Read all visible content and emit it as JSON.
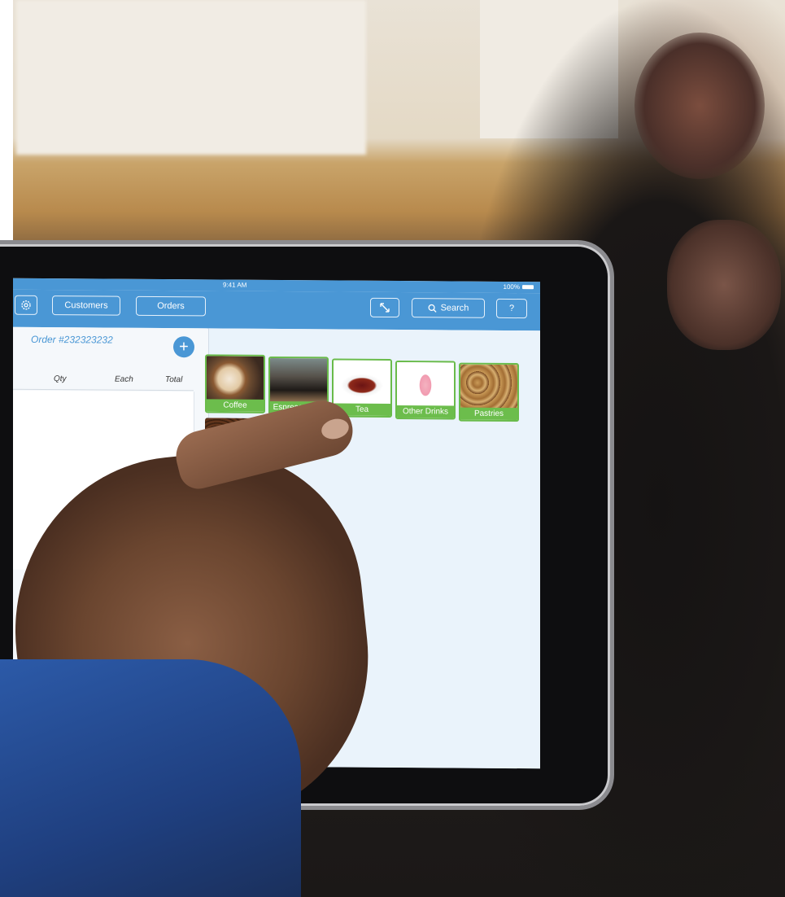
{
  "status_bar": {
    "time": "9:41 AM",
    "battery": "100%"
  },
  "toolbar": {
    "customers_label": "Customers",
    "orders_label": "Orders",
    "search_label": "Search",
    "help_label": "?"
  },
  "order": {
    "title": "Order #232323232",
    "add_label": "+",
    "columns": [
      "Qty",
      "Each",
      "Total"
    ]
  },
  "categories": [
    {
      "label": "Coffee"
    },
    {
      "label": "Espresso Dr..."
    },
    {
      "label": "Tea"
    },
    {
      "label": "Other Drinks"
    },
    {
      "label": "Pastries"
    }
  ],
  "colors": {
    "accent": "#4a97d5",
    "tile_green": "#6cbd4c",
    "panel_bg": "#eaf3fb"
  },
  "icons": [
    "gear-icon",
    "expand-icon",
    "search-icon",
    "plus-icon",
    "battery-icon"
  ]
}
